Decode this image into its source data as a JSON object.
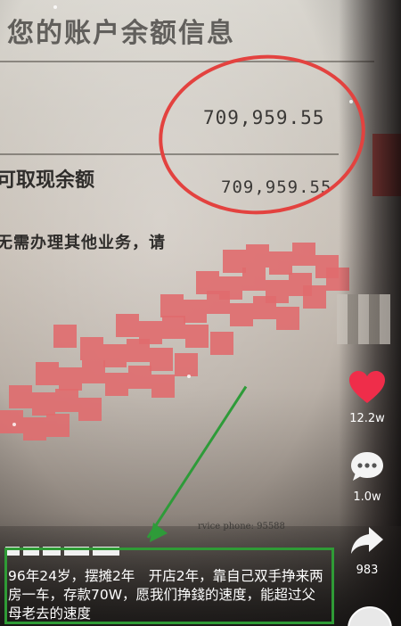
{
  "document": {
    "title": "您的账户余额信息",
    "balance_amount": "709,959.55",
    "withdrawable_label": "可取现余额",
    "withdrawable_amount": "709,959.55",
    "notice": "无需办理其他业务，请",
    "faint_service_text": "rvice phone: 95588"
  },
  "caption": {
    "text": "96年24岁，摆摊2年　开店2年，靠自己双手挣来两房一车，存款70W，愿我们挣錢的速度，能超过父母老去的速度"
  },
  "actions": {
    "like_count": "12.2w",
    "comment_count": "1.0w",
    "share_count": "983"
  },
  "icons": {
    "like": "heart-icon",
    "comment": "comment-icon",
    "share": "share-icon",
    "avatar": "avatar"
  },
  "colors": {
    "highlight_circle": "#e3423f",
    "caption_box": "#2f9b36",
    "heart": "#ef2d4a"
  }
}
